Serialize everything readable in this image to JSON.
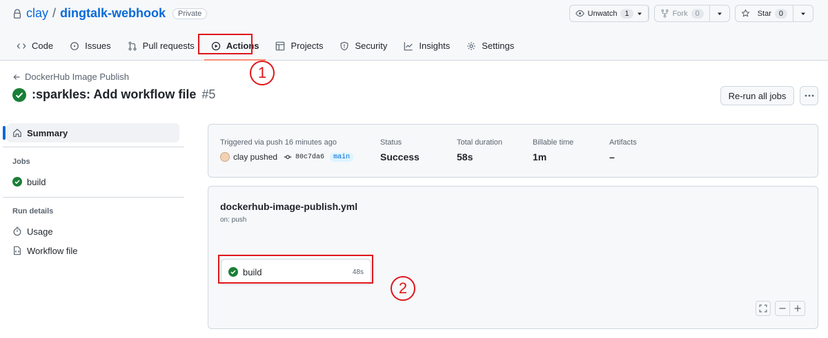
{
  "repo": {
    "owner": "clay",
    "separator": "/",
    "name": "dingtalk-webhook",
    "visibility": "Private"
  },
  "header_buttons": {
    "unwatch": {
      "label": "Unwatch",
      "count": "1"
    },
    "fork": {
      "label": "Fork",
      "count": "0"
    },
    "star": {
      "label": "Star",
      "count": "0"
    }
  },
  "nav": [
    {
      "label": "Code",
      "icon": "code-icon"
    },
    {
      "label": "Issues",
      "icon": "issue-icon"
    },
    {
      "label": "Pull requests",
      "icon": "pull-request-icon"
    },
    {
      "label": "Actions",
      "icon": "play-icon",
      "active": true
    },
    {
      "label": "Projects",
      "icon": "table-icon"
    },
    {
      "label": "Security",
      "icon": "shield-icon"
    },
    {
      "label": "Insights",
      "icon": "graph-icon"
    },
    {
      "label": "Settings",
      "icon": "gear-icon"
    }
  ],
  "annotations": {
    "one": "1",
    "two": "2"
  },
  "run": {
    "back_label": "DockerHub Image Publish",
    "title": ":sparkles: Add workflow file",
    "number": "#5",
    "rerun_label": "Re-run all jobs"
  },
  "sidebar": {
    "summary": "Summary",
    "jobs_heading": "Jobs",
    "job": "build",
    "run_details_heading": "Run details",
    "usage": "Usage",
    "workflow_file": "Workflow file"
  },
  "summary": {
    "trigger_label": "Triggered via push 16 minutes ago",
    "actor_text": "clay pushed",
    "commit": "80c7da6",
    "branch": "main",
    "status_label": "Status",
    "status_value": "Success",
    "duration_label": "Total duration",
    "duration_value": "58s",
    "billable_label": "Billable time",
    "billable_value": "1m",
    "artifacts_label": "Artifacts",
    "artifacts_value": "–"
  },
  "workflow": {
    "file": "dockerhub-image-publish.yml",
    "trigger": "on: push",
    "job_name": "build",
    "job_duration": "48s"
  },
  "colors": {
    "success": "#1a7f37",
    "link": "#0969da",
    "highlight": "#e0151a",
    "active_underline": "#fd8c73"
  }
}
